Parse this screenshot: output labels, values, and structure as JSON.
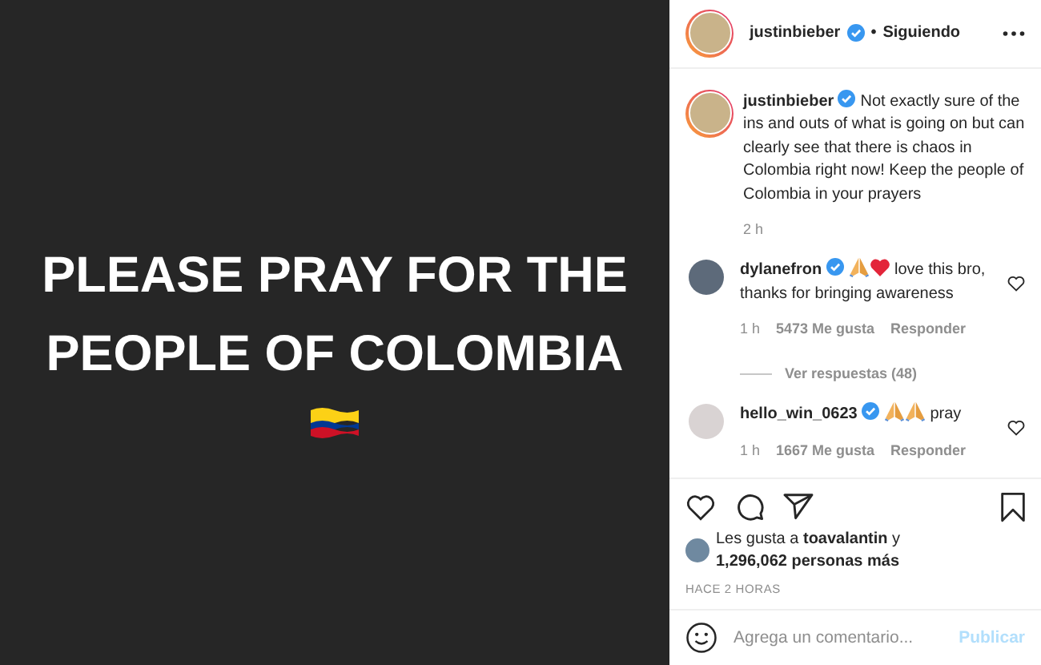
{
  "post": {
    "headline": "PLEASE PRAY FOR THE PEOPLE OF COLOMBIA"
  },
  "header": {
    "username": "justinbieber",
    "verified": true,
    "separator": "•",
    "follow_status": "Siguiendo"
  },
  "caption": {
    "username": "justinbieber",
    "verified": true,
    "text": "Not exactly sure of the ins and outs of what is going on but can clearly see that there is chaos in Colombia right now! Keep the people of Colombia in your prayers",
    "time": "2 h"
  },
  "comments": [
    {
      "username": "dylanefron",
      "verified": true,
      "emojis": [
        {
          "kind": "pray"
        },
        {
          "kind": "heart"
        }
      ],
      "text": "love this bro, thanks for bringing awareness",
      "time": "1 h",
      "likes": "5473 Me gusta",
      "reply": "Responder",
      "liked": false,
      "view_replies": "Ver respuestas (48)"
    },
    {
      "username": "hello_win_0623",
      "verified": true,
      "emojis": [
        {
          "kind": "pray"
        },
        {
          "kind": "pray"
        }
      ],
      "text": "pray",
      "time": "1 h",
      "likes": "1667 Me gusta",
      "reply": "Responder",
      "liked": false
    }
  ],
  "actions": {
    "liked": false,
    "saved": false
  },
  "likes": {
    "text": "Les gusta a **toavalantin** y **1,296,062 personas más**"
  },
  "timestamp": "HACE 2 HORAS",
  "comment_box": {
    "placeholder": "Agrega un comentario...",
    "submit": "Publicar",
    "submit_disabled": true
  }
}
